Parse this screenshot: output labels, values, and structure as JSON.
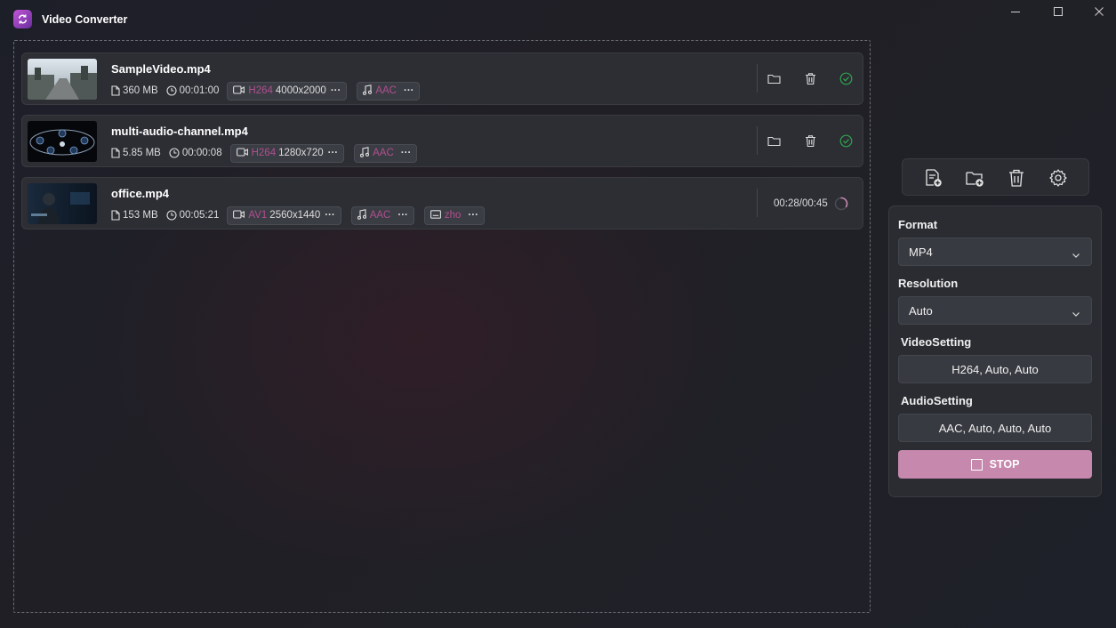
{
  "app": {
    "title": "Video Converter"
  },
  "files": [
    {
      "name": "SampleVideo.mp4",
      "size": "360 MB",
      "duration": "00:01:00",
      "video_codec": "H264",
      "resolution": "4000x2000",
      "audio_codec": "AAC",
      "subtitle": null,
      "status": "done"
    },
    {
      "name": "multi-audio-channel.mp4",
      "size": "5.85 MB",
      "duration": "00:00:08",
      "video_codec": "H264",
      "resolution": "1280x720",
      "audio_codec": "AAC",
      "subtitle": null,
      "status": "done"
    },
    {
      "name": "office.mp4",
      "size": "153 MB",
      "duration": "00:05:21",
      "video_codec": "AV1",
      "resolution": "2560x1440",
      "audio_codec": "AAC",
      "subtitle": "zho",
      "status": "converting",
      "progress": "00:28/00:45"
    }
  ],
  "settings": {
    "format_label": "Format",
    "format_value": "MP4",
    "resolution_label": "Resolution",
    "resolution_value": "Auto",
    "video_label": "VideoSetting",
    "video_value": "H264, Auto, Auto",
    "audio_label": "AudioSetting",
    "audio_value": "AAC, Auto, Auto, Auto",
    "stop_label": "STOP"
  },
  "colors": {
    "accent": "#c688ad",
    "codec": "#b04f8f",
    "success": "#2ea44f"
  }
}
